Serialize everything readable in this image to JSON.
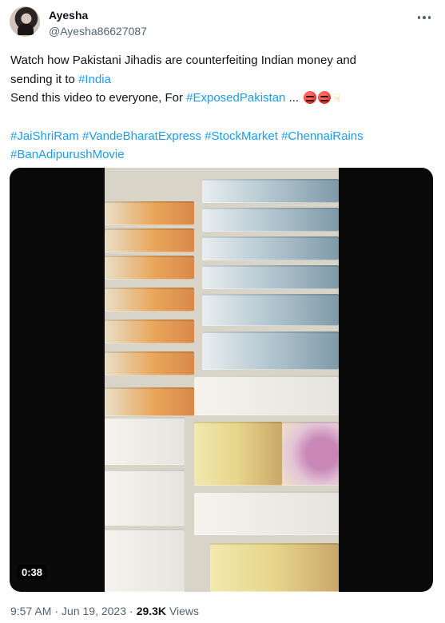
{
  "user": {
    "name": "Ayesha",
    "handle": "@Ayesha86627087"
  },
  "tweet": {
    "line1": "Watch how Pakistani Jihadis are counterfeiting Indian money and",
    "line2_text": "sending it to ",
    "line2_tag": "#India",
    "line3_text": "Send this video to everyone, For ",
    "line3_tag": "#ExposedPakistan",
    "line3_tail": " ...",
    "hashtags_line1": [
      "#JaiShriRam",
      "#VandeBharatExpress",
      "#StockMarket",
      "#ChennaiRains"
    ],
    "hashtags_line2": [
      "#BanAdipurushMovie"
    ]
  },
  "media": {
    "duration": "0:38"
  },
  "meta": {
    "time": "9:57 AM",
    "separator": "·",
    "date": "Jun 19, 2023",
    "views_count": "29.3K",
    "views_label": "Views"
  },
  "colors": {
    "link": "#1d9bf0",
    "text": "#0f1419",
    "muted": "#536471"
  },
  "icons": [
    "more-icon",
    "angry-face-emoji",
    "pointing-down-emoji"
  ]
}
